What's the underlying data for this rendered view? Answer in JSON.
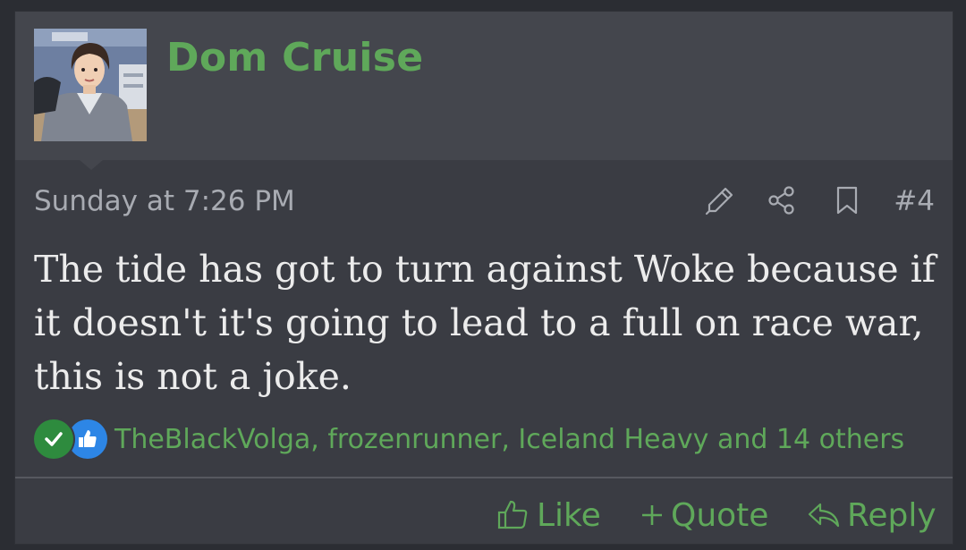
{
  "post": {
    "username": "Dom Cruise",
    "timestamp": "Sunday at 7:26 PM",
    "post_number": "#4",
    "message": "The tide has got to turn against Woke because if it doesn't it's going to lead to a full on race war, this is not a joke.",
    "reactions_text": "TheBlackVolga, frozenrunner, Iceland Heavy and 14 others"
  },
  "actions": {
    "like_label": "Like",
    "quote_label": "Quote",
    "reply_label": "Reply"
  },
  "icons": {
    "edit": "pencil-icon",
    "share": "share-icon",
    "bookmark": "bookmark-icon",
    "reaction_agree": "checkmark-icon",
    "reaction_like": "thumbs-up-icon",
    "like": "thumbs-up-outline-icon",
    "quote": "plus-icon",
    "reply": "reply-arrow-icon"
  },
  "colors": {
    "accent": "#5fa85a",
    "background": "#3a3c43",
    "header_background": "#44464d",
    "text": "#ececec",
    "muted_text": "#a8abb2",
    "agree_badge": "#2e8b3e",
    "like_badge": "#2d86e6"
  }
}
